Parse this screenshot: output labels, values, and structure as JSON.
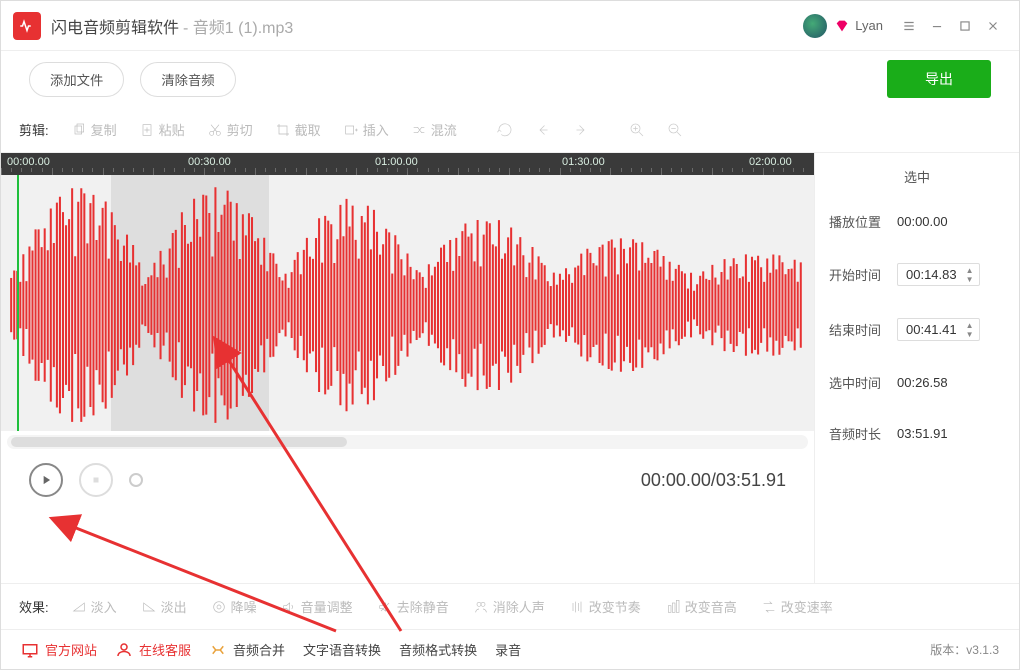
{
  "titlebar": {
    "app_name": "闪电音频剪辑软件",
    "file_name": "音频1 (1).mp3",
    "user_name": "Lyan"
  },
  "topbar": {
    "add_file": "添加文件",
    "clear_audio": "清除音频",
    "export": "导出"
  },
  "toolbar": {
    "label": "剪辑:",
    "copy": "复制",
    "paste": "粘贴",
    "cut": "剪切",
    "crop": "截取",
    "insert": "插入",
    "mix": "混流"
  },
  "ruler": {
    "t0": "00:00.00",
    "t1": "00:30.00",
    "t2": "01:00.00",
    "t3": "01:30.00",
    "t4": "02:00.00"
  },
  "transport": {
    "time": "00:00.00/03:51.91"
  },
  "sidepanel": {
    "title": "选中",
    "play_pos_label": "播放位置",
    "play_pos": "00:00.00",
    "start_label": "开始时间",
    "start": "00:14.83",
    "end_label": "结束时间",
    "end": "00:41.41",
    "sel_label": "选中时间",
    "sel": "00:26.58",
    "dur_label": "音频时长",
    "dur": "03:51.91"
  },
  "effects": {
    "label": "效果:",
    "fade_in": "淡入",
    "fade_out": "淡出",
    "denoise": "降噪",
    "volume": "音量调整",
    "silence": "去除静音",
    "vocal": "消除人声",
    "tempo": "改变节奏",
    "pitch": "改变音高",
    "speed": "改变速率"
  },
  "bottombar": {
    "site": "官方网站",
    "support": "在线客服",
    "merge": "音频合并",
    "tts": "文字语音转换",
    "format": "音频格式转换",
    "record": "录音",
    "version": "版本：v3.1.3"
  },
  "selection_region": {
    "left_pct": 13.5,
    "width_pct": 19.5
  }
}
